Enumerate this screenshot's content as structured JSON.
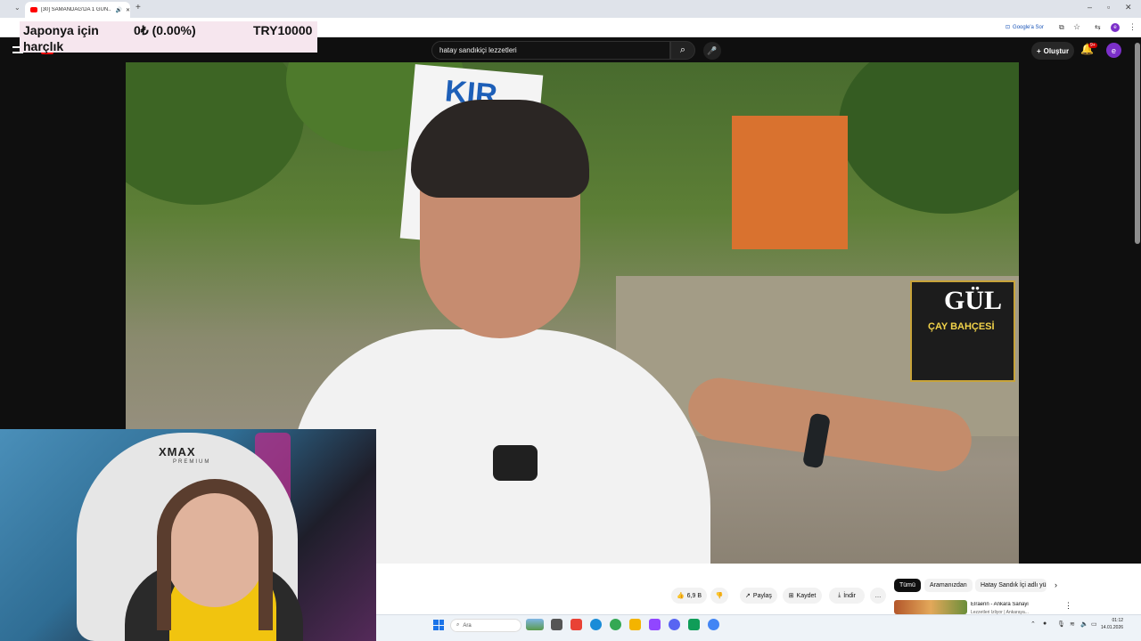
{
  "browser": {
    "tab_title": "[30] SAMANDAĞ'DA 1 GÜN...",
    "google_ask": "Google'a Sor"
  },
  "overlay": {
    "label_line1": "Japonya için",
    "label_line2": "harçlık",
    "amount": "0₺ (0.00%)",
    "goal": "TRY10000"
  },
  "youtube": {
    "search_value": "hatay sandıkiçi lezzetleri",
    "create_label": "Oluştur",
    "notif_count": "9+",
    "avatar_letter": "e"
  },
  "video": {
    "sign_text": "KIR",
    "gul_text": "GÜL",
    "gul_sub": "ÇAY BAHÇESİ"
  },
  "webcam": {
    "chair_brand": "XMAX",
    "chair_sub": "PREMIUM"
  },
  "actions": {
    "like_count": "6,9 B",
    "share": "Paylaş",
    "save": "Kaydet",
    "download": "İndir"
  },
  "chips": {
    "all": "Tümü",
    "from_search": "Aramanızdan",
    "hatay": "Hatay Sandık İçi adlı yükleme"
  },
  "recommendation": {
    "channel": "Elraenn - Ankara Sanayi",
    "title": "Lezzetleri İzliyor | Ankaraya..."
  },
  "taskbar": {
    "search_placeholder": "Ara",
    "time": "01:12",
    "date": "14.01.2026"
  }
}
